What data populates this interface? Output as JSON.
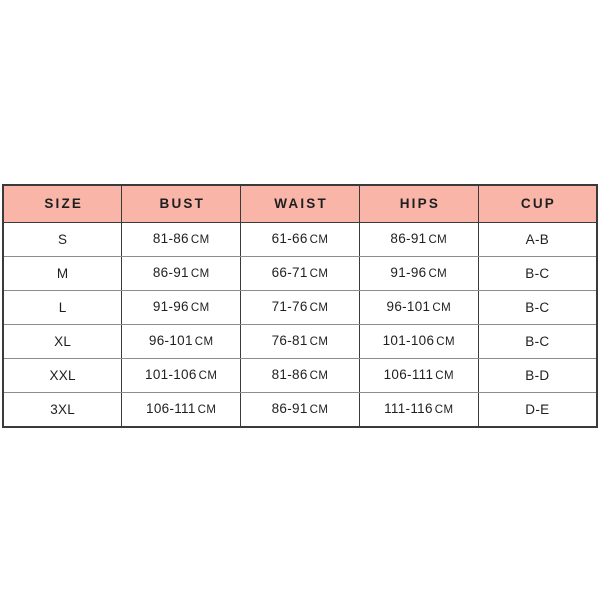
{
  "table": {
    "headers": [
      {
        "id": "size",
        "label": "SIZE"
      },
      {
        "id": "bust",
        "label": "BUST"
      },
      {
        "id": "waist",
        "label": "WAIST"
      },
      {
        "id": "hips",
        "label": "HIPS"
      },
      {
        "id": "cup",
        "label": "CUP"
      }
    ],
    "unit": "CM",
    "rows": [
      {
        "size": "S",
        "bust": "81-86",
        "bust_unit": "CM",
        "waist": "61-66",
        "waist_unit": "CM",
        "hips": "86-91",
        "hips_unit": "CM",
        "cup": "A-B"
      },
      {
        "size": "M",
        "bust": "86-91",
        "bust_unit": "CM",
        "waist": "66-71",
        "waist_unit": "CM",
        "hips": "91-96",
        "hips_unit": "CM",
        "cup": "B-C"
      },
      {
        "size": "L",
        "bust": "91-96",
        "bust_unit": "CM",
        "waist": "71-76",
        "waist_unit": "CM",
        "hips": "96-101",
        "hips_unit": "CM",
        "cup": "B-C"
      },
      {
        "size": "XL",
        "bust": "96-101",
        "bust_unit": "CM",
        "waist": "76-81",
        "waist_unit": "CM",
        "hips": "101-106",
        "hips_unit": "CM",
        "cup": "B-C"
      },
      {
        "size": "XXL",
        "bust": "101-106",
        "bust_unit": "CM",
        "waist": "81-86",
        "waist_unit": "CM",
        "hips": "106-111",
        "hips_unit": "CM",
        "cup": "B-D"
      },
      {
        "size": "3XL",
        "bust": "106-111",
        "bust_unit": "CM",
        "waist": "86-91",
        "waist_unit": "CM",
        "hips": "111-116",
        "hips_unit": "CM",
        "cup": "D-E"
      }
    ]
  },
  "colors": {
    "header_background": "#F9B5A8",
    "page_background": "#FFFFFF",
    "outer_border": "#3A3A3A",
    "row_divider": "#8D8D8D",
    "text": "#1F1F1F"
  }
}
